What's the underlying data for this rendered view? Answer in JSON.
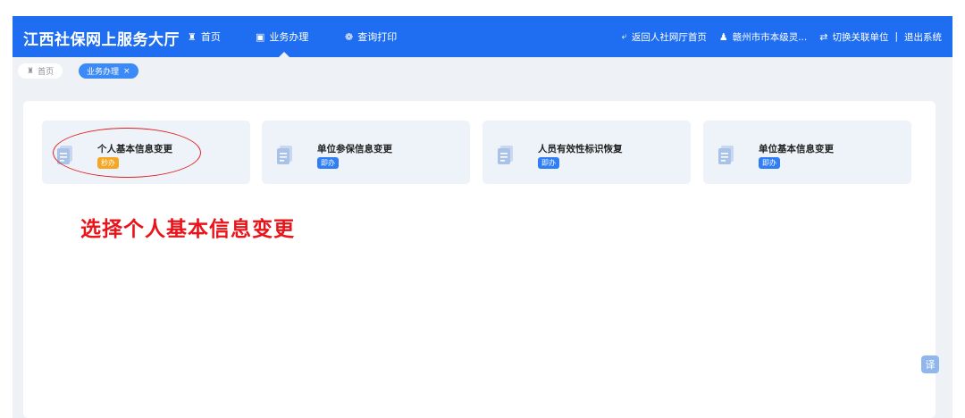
{
  "header": {
    "logo": "江西社保网上服务大厅",
    "nav": [
      {
        "label": "首页",
        "icon": "home-icon"
      },
      {
        "label": "业务办理",
        "icon": "briefcase-icon"
      },
      {
        "label": "查询打印",
        "icon": "print-icon"
      }
    ],
    "right": {
      "back_home": "返回人社网厅首页",
      "user": "赣州市市本级灵...",
      "switch_unit": "切换关联单位",
      "separator": "|",
      "logout": "退出系统"
    }
  },
  "tags": {
    "home": "首页",
    "current": "业务办理",
    "close_symbol": "×"
  },
  "cards": [
    {
      "title": "个人基本信息变更",
      "badge": "秒办",
      "badge_color": "#f5a623"
    },
    {
      "title": "单位参保信息变更",
      "badge": "即办",
      "badge_color": "#2f7ef5"
    },
    {
      "title": "人员有效性标识恢复",
      "badge": "即办",
      "badge_color": "#2f7ef5"
    },
    {
      "title": "单位基本信息变更",
      "badge": "即办",
      "badge_color": "#2f7ef5"
    }
  ],
  "annotation": {
    "text": "选择个人基本信息变更",
    "color": "#e8141a"
  },
  "float_button": {
    "label": "译"
  },
  "colors": {
    "brand": "#1f6ef2",
    "tag_active": "#3b8af7",
    "background": "#eef1f6"
  }
}
